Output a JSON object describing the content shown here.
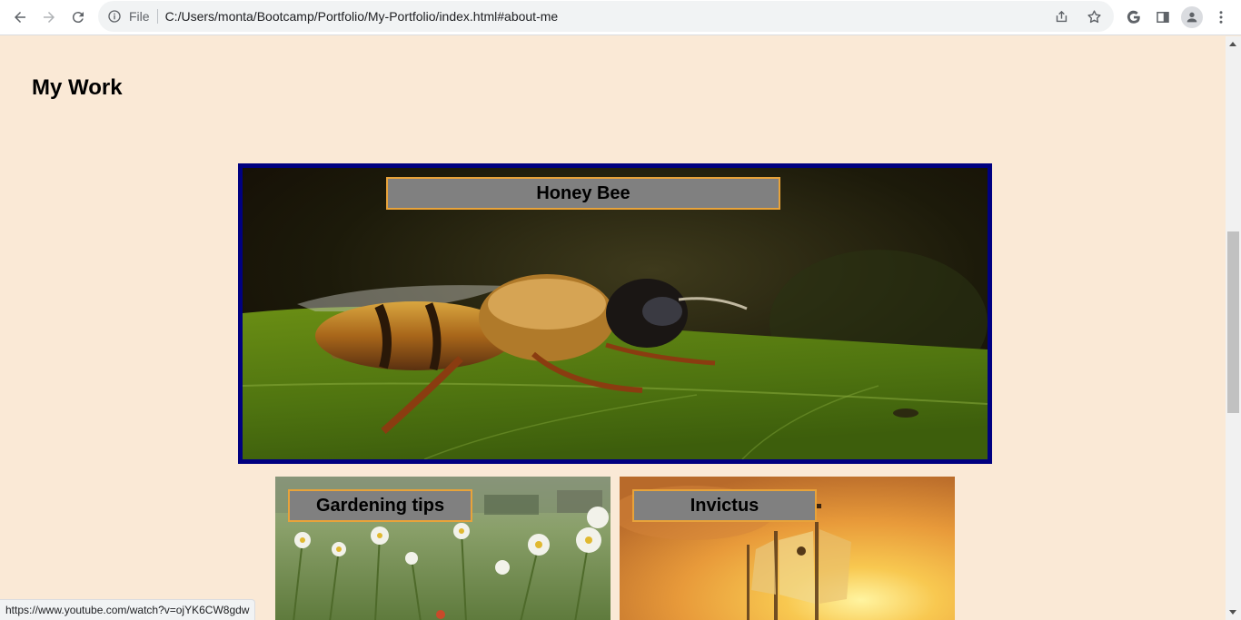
{
  "browser": {
    "scheme_chip": "File",
    "url": "C:/Users/monta/Bootcamp/Portfolio/My-Portfolio/index.html#about-me",
    "status_url": "https://www.youtube.com/watch?v=ojYK6CW8gdw"
  },
  "section": {
    "title": "My Work"
  },
  "projects": [
    {
      "label": "Honey Bee",
      "image": "bee-on-leaf-photo"
    },
    {
      "label": "Gardening tips",
      "image": "daisy-garden-photo"
    },
    {
      "label": "Invictus",
      "image": "pirate-ship-sunset-photo"
    }
  ],
  "colors": {
    "page_background": "#fae9d6",
    "featured_border": "#000080",
    "label_background": "#808080",
    "label_border": "#e8a33a"
  }
}
